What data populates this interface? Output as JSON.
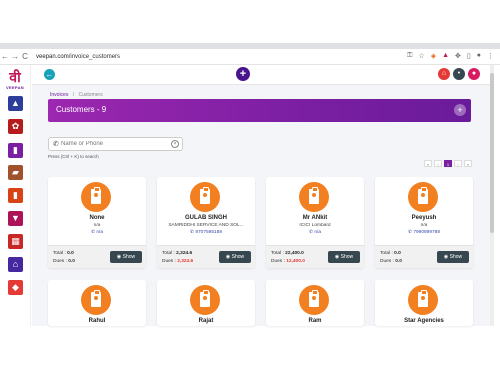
{
  "browser": {
    "url_domain": "veepan.com",
    "url_path": "/invoice_customers",
    "nav_back": "←",
    "nav_forward": "→",
    "nav_reload": "C"
  },
  "sidebar": {
    "logo_mark": "वी",
    "logo_text": "VEEPAN",
    "items": [
      {
        "icon": "chart-icon",
        "glyph": "▲",
        "color": "#2c3e9a"
      },
      {
        "icon": "settings-icon",
        "glyph": "✿",
        "color": "#b71c1c"
      },
      {
        "icon": "document-icon",
        "glyph": "▮",
        "color": "#7b1fa2"
      },
      {
        "icon": "folder-icon",
        "glyph": "▰",
        "color": "#a0522d"
      },
      {
        "icon": "bag-icon",
        "glyph": "▮",
        "color": "#d84315"
      },
      {
        "icon": "basket-icon",
        "glyph": "▼",
        "color": "#ad1457"
      },
      {
        "icon": "calendar-icon",
        "glyph": "▦",
        "color": "#c62828"
      },
      {
        "icon": "bank-icon",
        "glyph": "⌂",
        "color": "#4527a0"
      },
      {
        "icon": "tag-icon",
        "glyph": "◆",
        "color": "#e53935"
      }
    ]
  },
  "topbar": {
    "back_glyph": "←",
    "add_glyph": "+",
    "home_glyph": "⌂",
    "bell_glyph": "•",
    "user_glyph": "●"
  },
  "breadcrumb": {
    "parent": "Invoices",
    "separator": "/",
    "current": "Customers"
  },
  "header": {
    "title": "Customers - 9",
    "add_glyph": "+"
  },
  "search": {
    "placeholder": "Name or Phone",
    "value": "",
    "hint": "Press (Ctrl + K) to search",
    "clear_glyph": "×"
  },
  "pager": {
    "prev2": "«",
    "prev": "‹",
    "current": "1",
    "next": "›",
    "next2": "»"
  },
  "labels": {
    "total": "Total :",
    "dues": "Dues :",
    "show": "Show",
    "eye": "◉",
    "phone_glyph": "✆"
  },
  "customers": [
    {
      "name": "None",
      "sub": "n/a",
      "phone": "n/a",
      "total": "0.0",
      "dues": "0.0"
    },
    {
      "name": "GULAB SINGH",
      "sub": "SAMRIDDHI SERVICE AND SOL...",
      "phone": "8707595188",
      "total": "2,324.6",
      "dues": "2,324.6"
    },
    {
      "name": "Mr ANkit",
      "sub": "ICICI Lombard",
      "phone": "n/a",
      "total": "22,400.0",
      "dues": "12,400.0"
    },
    {
      "name": "Peeyush",
      "sub": "n/a",
      "phone": "7990899788",
      "total": "0.0",
      "dues": "0.0"
    },
    {
      "name": "Rahul",
      "sub": "",
      "phone": "",
      "total": "",
      "dues": ""
    },
    {
      "name": "Rajat",
      "sub": "",
      "phone": "",
      "total": "",
      "dues": ""
    },
    {
      "name": "Ram",
      "sub": "",
      "phone": "",
      "total": "",
      "dues": ""
    },
    {
      "name": "Star Agencies",
      "sub": "",
      "phone": "",
      "total": "",
      "dues": ""
    }
  ]
}
